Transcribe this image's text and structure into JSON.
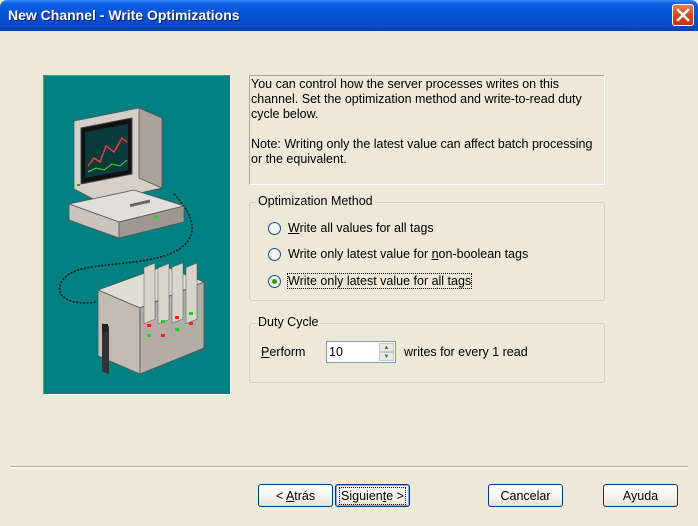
{
  "window": {
    "title": "New Channel - Write Optimizations"
  },
  "info": {
    "line1": "You can control how the server processes writes on this channel.  Set the optimization method and write-to-read duty cycle below.",
    "line2": "Note:  Writing only the latest value can affect batch processing or the equivalent."
  },
  "optimization": {
    "group_label": "Optimization Method",
    "options": [
      {
        "pre": "",
        "mnemonic": "W",
        "post": "rite all values for all tags",
        "checked": false
      },
      {
        "pre": "Write only latest value for ",
        "mnemonic": "n",
        "post": "on-boolean tags",
        "checked": false
      },
      {
        "pre": "Write only latest value for all tags",
        "mnemonic": "",
        "post": "",
        "checked": true
      }
    ]
  },
  "duty_cycle": {
    "group_label": "Duty Cycle",
    "perform_mnemonic": "P",
    "perform_rest": "erform",
    "value": "10",
    "suffix": "writes for every 1 read"
  },
  "buttons": {
    "back_pre": "< ",
    "back_mnemonic": "A",
    "back_post": "trás",
    "next_pre": "Siguien",
    "next_mnemonic": "t",
    "next_post": "e >",
    "cancel": "Cancelar",
    "help": "Ayuda"
  },
  "icons": {
    "close": "close-icon",
    "illustration": "computer-and-server-illustration"
  },
  "colors": {
    "titlebar": "#0553d6",
    "illustration_bg": "#008080",
    "dialog_bg": "#ece9d8",
    "close_button": "#d5431c"
  }
}
